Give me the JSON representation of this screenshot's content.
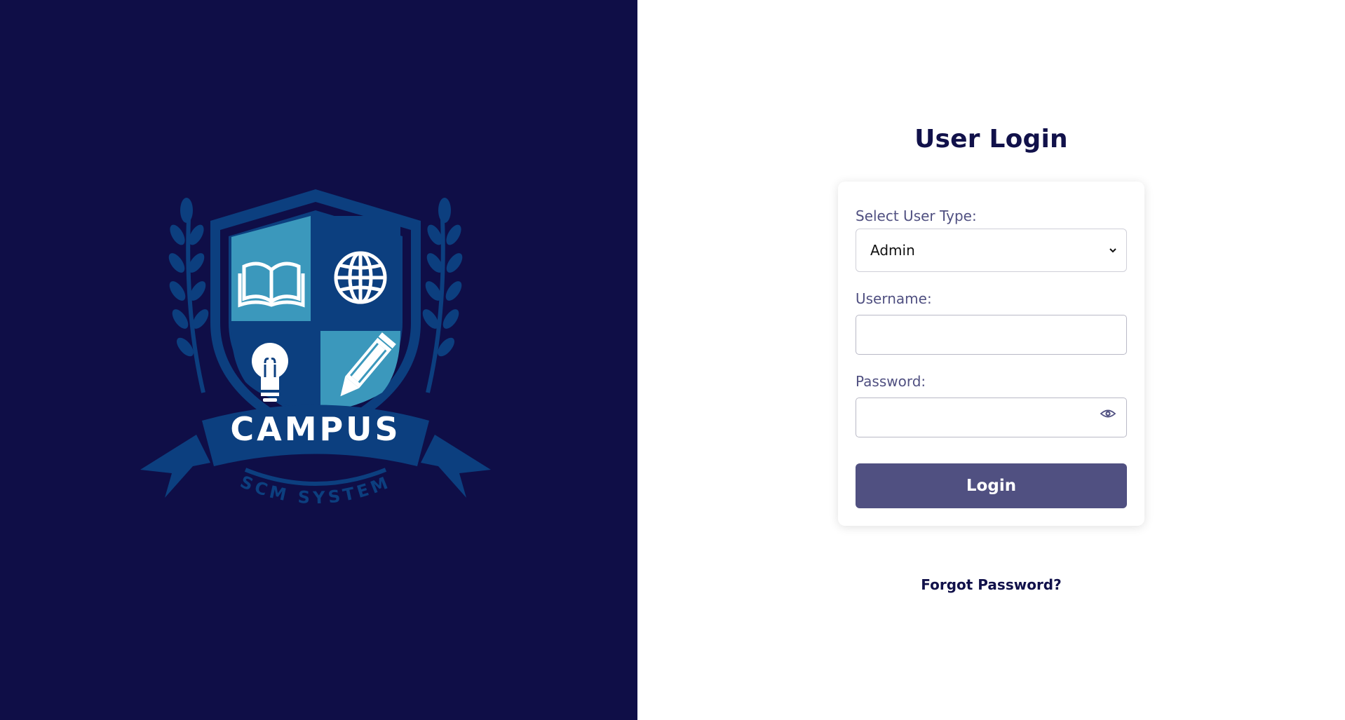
{
  "branding": {
    "logo_text": "CAMPUS",
    "logo_subtext": "SCM SYSTEM",
    "colors": {
      "background": "#0f0e47",
      "shield_dark": "#0c3f7f",
      "shield_light": "#3b98bc",
      "white": "#ffffff"
    }
  },
  "login": {
    "title": "User Login",
    "user_type_label": "Select User Type:",
    "user_type_value": "Admin",
    "username_label": "Username:",
    "username_value": "",
    "password_label": "Password:",
    "password_value": "",
    "submit_label": "Login",
    "forgot_label": "Forgot Password?",
    "accent_color": "#505081"
  }
}
